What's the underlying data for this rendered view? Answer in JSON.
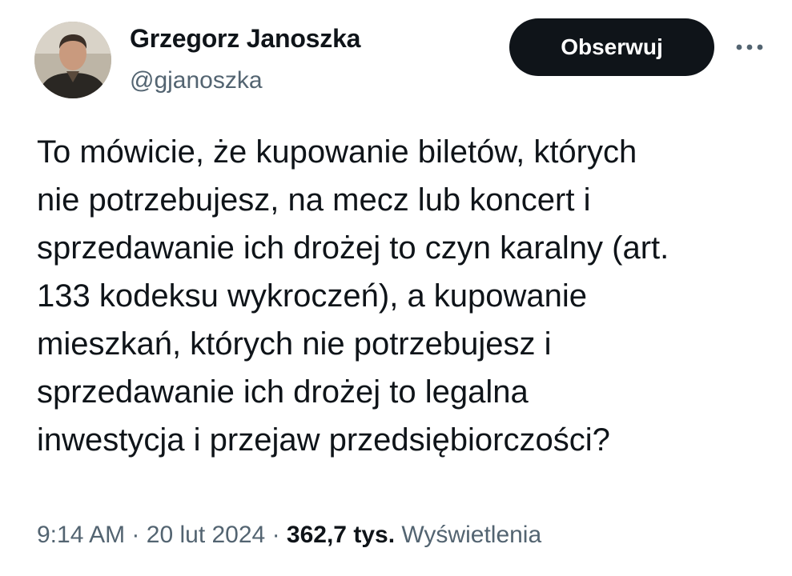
{
  "author": {
    "name": "Grzegorz Janoszka",
    "handle": "@gjanoszka"
  },
  "actions": {
    "follow_label": "Obserwuj",
    "more_icon": "more-horizontal-icon"
  },
  "tweet": {
    "lines": [
      "To mówicie, że kupowanie biletów, których",
      "nie potrzebujesz, na mecz lub koncert i",
      "sprzedawanie ich drożej to czyn karalny (art.",
      "133 kodeksu wykroczeń), a kupowanie",
      "mieszkań, których nie potrzebujesz i",
      "sprzedawanie ich drożej to legalna",
      "inwestycja i przejaw przedsiębiorczości?"
    ]
  },
  "meta": {
    "time": "9:14 AM",
    "separator": "·",
    "date": "20 lut 2024",
    "views_count": "362,7 tys.",
    "views_label": "Wyświetlenia"
  },
  "colors": {
    "text_primary": "#0f1419",
    "text_secondary": "#536471",
    "button_bg": "#0f1419",
    "button_text": "#ffffff",
    "background": "#ffffff"
  }
}
